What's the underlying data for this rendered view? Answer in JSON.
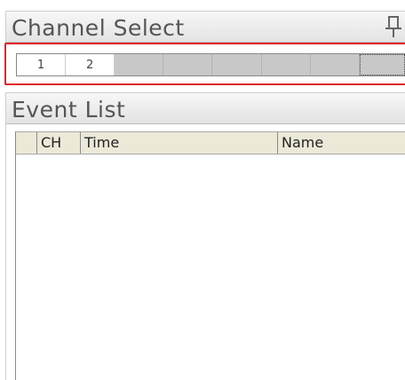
{
  "channel_select": {
    "title": "Channel Select",
    "channels": [
      "1",
      "2",
      "",
      "",
      "",
      "",
      "",
      ""
    ]
  },
  "event_list": {
    "title": "Event List",
    "columns": [
      "",
      "CH",
      "Time",
      "Name"
    ]
  },
  "colors": {
    "highlight": "#e0242a"
  },
  "icons": {
    "pin": "pin-icon"
  }
}
